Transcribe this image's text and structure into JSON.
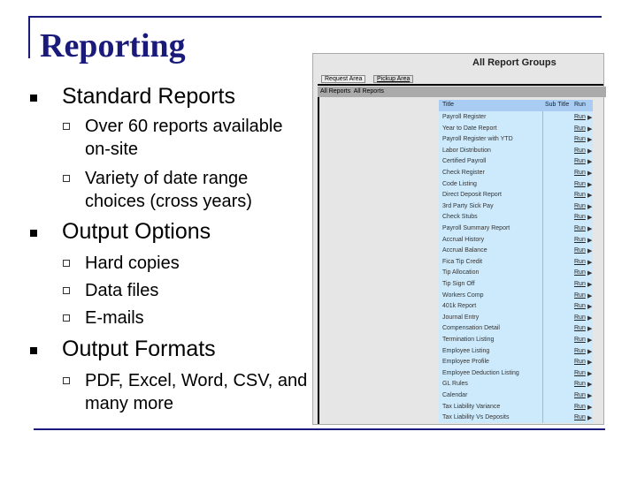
{
  "title": "Reporting",
  "sections": [
    {
      "heading": "Standard Reports",
      "items": [
        "Over 60 reports available on-site",
        "Variety of date range choices (cross years)"
      ]
    },
    {
      "heading": "Output Options",
      "items": [
        "Hard copies",
        "Data files",
        "E-mails"
      ]
    },
    {
      "heading": "Output Formats",
      "items": [
        "PDF, Excel, Word, CSV, and many more"
      ]
    }
  ],
  "screenshot": {
    "heading": "All Report Groups",
    "tabs": [
      "Request Area",
      "Pickup Area"
    ],
    "breadcrumb": "All Reports  All Reports",
    "columns": [
      "Title",
      "Sub Title",
      "Run"
    ],
    "run_label": "Run",
    "reports": [
      "Payroll Register",
      "Year to Date Report",
      "Payroll Register with YTD",
      "Labor Distribution",
      "Certified Payroll",
      "Check Register",
      "Code Listing",
      "Direct Deposit Report",
      "3rd Party Sick Pay",
      "Check Stubs",
      "Payroll Summary Report",
      "Accrual History",
      "Accrual Balance",
      "Fica Tip Credit",
      "Tip Allocation",
      "Tip Sign Off",
      "Workers Comp",
      "401k Report",
      "Journal Entry",
      "Compensation Detail",
      "Termination Listing",
      "Employee Listing",
      "Employee Profile",
      "Employee Deduction Listing",
      "GL Rules",
      "Calendar",
      "Tax Liability Variance",
      "Tax Liability Vs Deposits"
    ]
  },
  "colors": {
    "title": "#1a1a7a",
    "table_bg": "#cdeafc",
    "header_bg": "#a9cdf2"
  }
}
